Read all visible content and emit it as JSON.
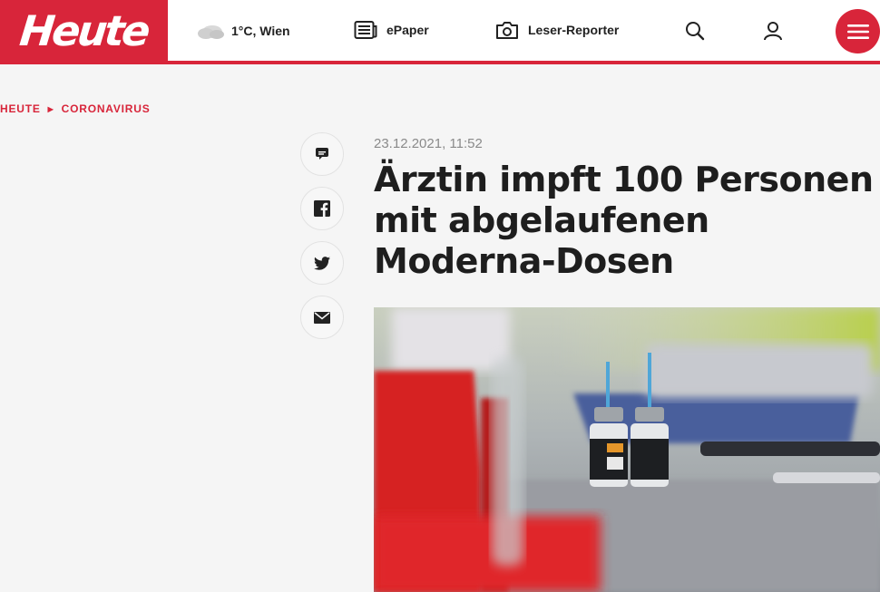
{
  "header": {
    "logo_text": "Heute",
    "weather": "1°C, Wien",
    "nav": {
      "epaper": "ePaper",
      "reporter": "Leser-Reporter"
    },
    "icons": [
      "cloud-icon",
      "newspaper-icon",
      "camera-icon",
      "search-icon",
      "user-icon",
      "menu-icon"
    ]
  },
  "breadcrumb": {
    "home": "HEUTE",
    "category": "CORONAVIRUS"
  },
  "share": [
    "comment-icon",
    "facebook-icon",
    "twitter-icon",
    "mail-icon"
  ],
  "article": {
    "date": "23.12.2021, 11:52",
    "title": "Ärztin impft 100 Personen mit abgelaufenen Moderna-Dosen"
  },
  "colors": {
    "brand": "#d8253a",
    "background": "#f5f5f5"
  }
}
